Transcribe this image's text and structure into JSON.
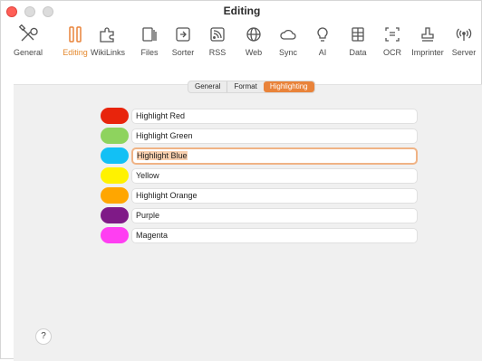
{
  "window": {
    "title": "Editing"
  },
  "toolbar": {
    "items": [
      {
        "label": "General",
        "icon": "tools-icon"
      },
      {
        "label": "Editing",
        "icon": "editing-icon",
        "active": true
      },
      {
        "label": "WikiLinks",
        "icon": "puzzle-icon"
      },
      {
        "label": "Files",
        "icon": "files-icon"
      },
      {
        "label": "Sorter",
        "icon": "sorter-icon"
      },
      {
        "label": "RSS",
        "icon": "rss-icon"
      },
      {
        "label": "Web",
        "icon": "globe-icon"
      },
      {
        "label": "Sync",
        "icon": "cloud-icon"
      },
      {
        "label": "AI",
        "icon": "lightbulb-icon"
      },
      {
        "label": "Data",
        "icon": "data-icon"
      },
      {
        "label": "OCR",
        "icon": "ocr-icon"
      },
      {
        "label": "Imprinter",
        "icon": "stamp-icon"
      },
      {
        "label": "Server",
        "icon": "broadcast-icon"
      }
    ]
  },
  "tabs": [
    {
      "label": "General",
      "selected": false
    },
    {
      "label": "Format",
      "selected": false
    },
    {
      "label": "Highlighting",
      "selected": true
    }
  ],
  "highlights": [
    {
      "name": "Highlight Red",
      "color": "#e8240c"
    },
    {
      "name": "Highlight Green",
      "color": "#8ed35e"
    },
    {
      "name": "Highlight Blue",
      "color": "#12c0f5",
      "focused": true
    },
    {
      "name": "Yellow",
      "color": "#fff200"
    },
    {
      "name": "Highlight Orange",
      "color": "#ffa600"
    },
    {
      "name": "Purple",
      "color": "#7f1a87"
    },
    {
      "name": "Magenta",
      "color": "#ff3ef2"
    }
  ],
  "help": {
    "label": "?"
  },
  "colors": {
    "accent": "#e9833a"
  }
}
